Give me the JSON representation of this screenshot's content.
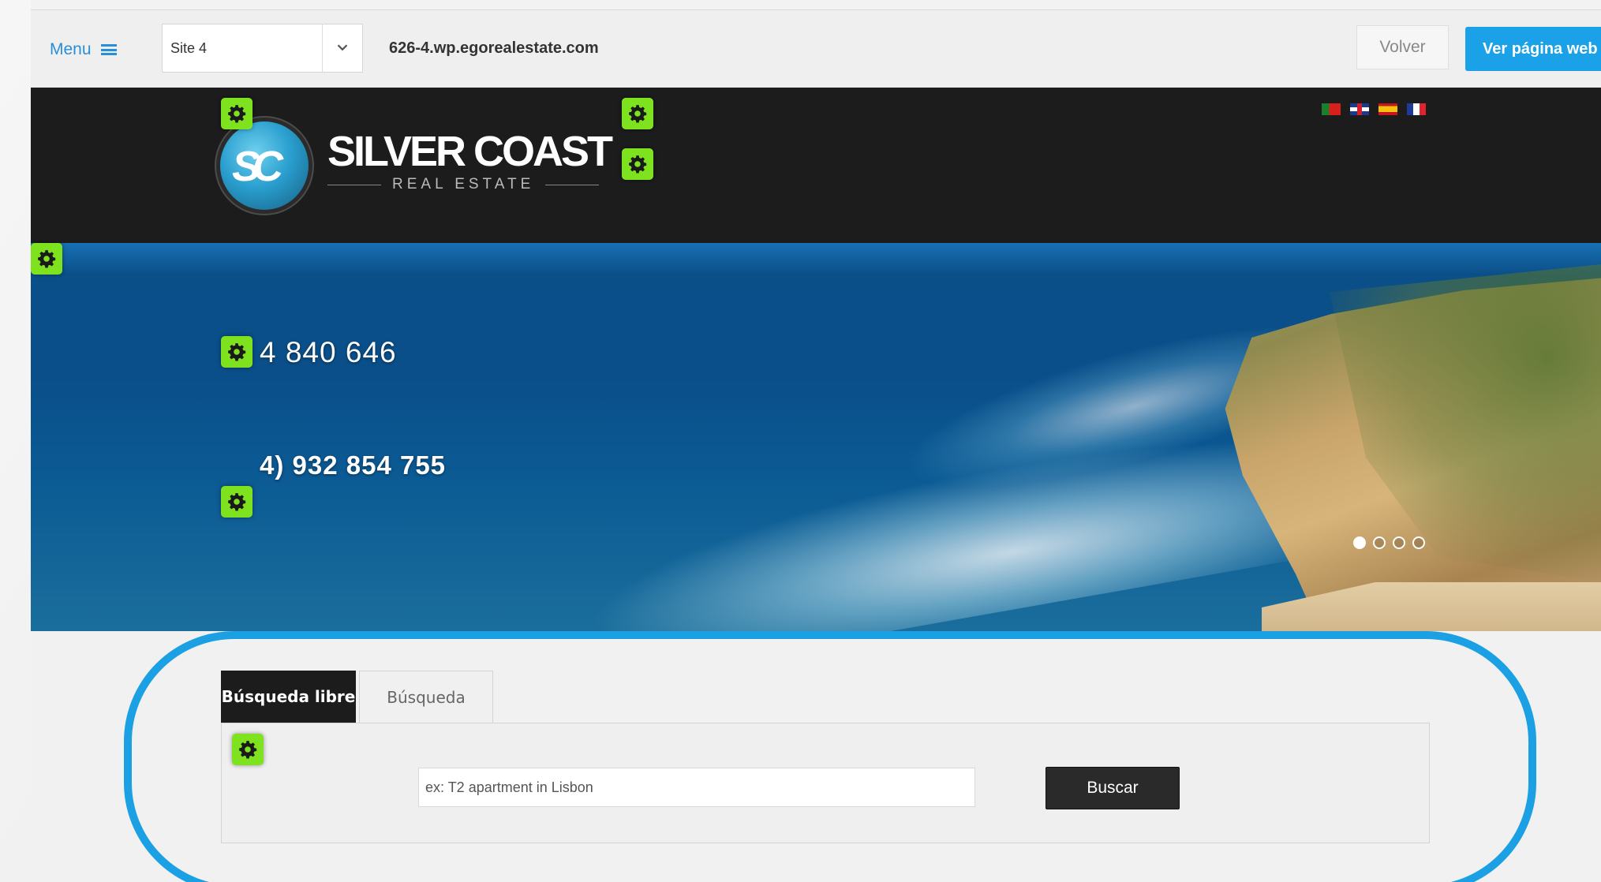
{
  "admin_bar": {
    "menu_label": "Menu",
    "site_select_value": "Site 4",
    "domain": "626-4.wp.egorealestate.com",
    "back_label": "Volver",
    "view_site_label": "Ver página web"
  },
  "header": {
    "logo_initials": "SC",
    "logo_title": "SILVER COAST",
    "logo_subtitle": "REAL ESTATE",
    "languages": [
      "pt-flag-icon",
      "uk-flag-icon",
      "es-flag-icon",
      "fr-flag-icon"
    ]
  },
  "hero": {
    "phone_1": "4 840 646",
    "phone_2": "4) 932 854 755",
    "slides_total": 4,
    "active_slide": 1
  },
  "search": {
    "tab_free": "Búsqueda libre",
    "tab_search": "Búsqueda",
    "input_placeholder": "ex: T2 apartment in Lisbon",
    "submit_label": "Buscar"
  },
  "colors": {
    "accent_blue": "#1ba1e8",
    "gear_green": "#7fe21e",
    "header_dark": "#1c1c1c"
  }
}
